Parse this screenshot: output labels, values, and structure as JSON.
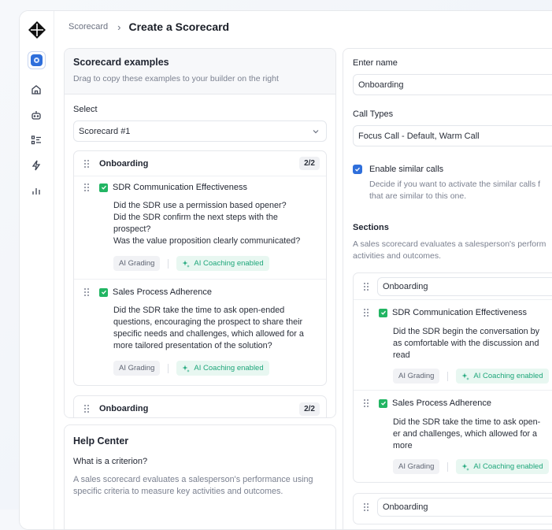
{
  "breadcrumb": {
    "parent": "Scorecard",
    "current": "Create a Scorecard"
  },
  "examples": {
    "title": "Scorecard examples",
    "subtitle": "Drag to copy these examples to your builder on the right",
    "select_label": "Select",
    "select_value": "Scorecard #1",
    "section": {
      "title": "Onboarding",
      "count": "2/2",
      "criteria": [
        {
          "name": "SDR Communication Effectiveness",
          "questions": [
            "Did the SDR use a permission based opener?",
            "Did the SDR confirm the next steps with the prospect?",
            "Was the value proposition clearly communicated?"
          ],
          "tag_grading": "AI Grading",
          "tag_coaching": "AI Coaching enabled"
        },
        {
          "name": "Sales Process Adherence",
          "questions": [
            "Did the SDR take the time to ask open-ended questions, encouraging the prospect to share their specific needs and challenges, which allowed for a more tailored presentation of the solution?"
          ],
          "tag_grading": "AI Grading",
          "tag_coaching": "AI Coaching enabled"
        }
      ]
    },
    "section2": {
      "title": "Onboarding",
      "count": "2/2"
    }
  },
  "help": {
    "title": "Help Center",
    "question": "What is a criterion?",
    "answer": "A sales scorecard evaluates a salesperson's performance using specific criteria to measure key activities and outcomes."
  },
  "builder": {
    "name_label": "Enter name",
    "name_value": "Onboarding",
    "call_types_label": "Call Types",
    "call_types_value": "Focus Call - Default, Warm Call",
    "similar_label": "Enable similar calls",
    "similar_desc": "Decide if you want to activate the similar calls f that are similar to this one.",
    "sections_label": "Sections",
    "sections_desc": "A sales scorecard evaluates a salesperson's perform activities and outcomes.",
    "section_name": "Onboarding",
    "criteria": [
      {
        "name": "SDR Communication Effectiveness",
        "desc": "Did the SDR begin the conversation by as comfortable with the discussion and read",
        "tag_grading": "AI Grading",
        "tag_coaching": "AI Coaching enabled"
      },
      {
        "name": "Sales Process Adherence",
        "desc": "Did the SDR take the time to ask open-er and challenges, which allowed for a more",
        "tag_grading": "AI Grading",
        "tag_coaching": "AI Coaching enabled"
      }
    ],
    "section2_name": "Onboarding"
  },
  "colors": {
    "accent": "#2f6fdb",
    "check_green": "#22b563",
    "coach_teal": "#1ea67a"
  },
  "icons": [
    "logo-icon",
    "workspace-icon",
    "home-icon",
    "bot-icon",
    "list-icon",
    "bolt-icon",
    "chart-icon",
    "chevron-right-icon",
    "chevron-down-icon",
    "grip-icon",
    "check-icon",
    "sparkle-icon"
  ]
}
